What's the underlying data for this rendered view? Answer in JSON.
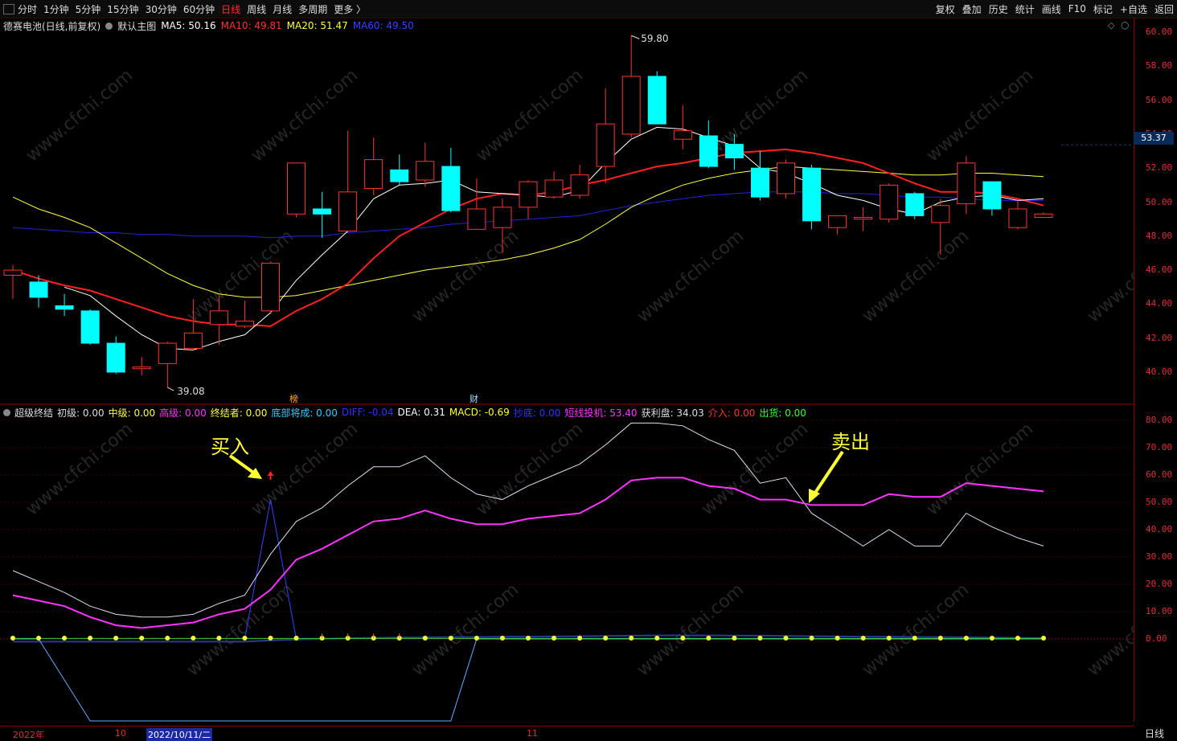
{
  "toolbar": {
    "periods": [
      "分时",
      "1分钟",
      "5分钟",
      "15分钟",
      "30分钟",
      "60分钟",
      "日线",
      "周线",
      "月线",
      "多周期",
      "更多 〉"
    ],
    "active_period": "日线",
    "right_buttons": [
      "复权",
      "叠加",
      "历史",
      "统计",
      "画线",
      "F10",
      "标记",
      "+自选",
      "返回"
    ]
  },
  "main_info": {
    "stock_name": "德赛电池(日线,前复权)",
    "template": "默认主图",
    "ma5": "MA5: 50.16",
    "ma10": "MA10: 49.81",
    "ma20": "MA20: 51.47",
    "ma60": "MA60: 49.50"
  },
  "indicator_info": {
    "name": "超级终结",
    "items": [
      {
        "text": "初级: 0.00",
        "color": "#dddddd"
      },
      {
        "text": "中级: 0.00",
        "color": "#ffff33"
      },
      {
        "text": "高级: 0.00",
        "color": "#ff33ff"
      },
      {
        "text": "终结者: 0.00",
        "color": "#ffff33"
      },
      {
        "text": "底部将成: 0.00",
        "color": "#33ccff"
      },
      {
        "text": "DIFF: -0.04",
        "color": "#3333ff"
      },
      {
        "text": "DEA: 0.31",
        "color": "#ffffff"
      },
      {
        "text": "MACD: -0.69",
        "color": "#ffff33"
      },
      {
        "text": "抄底: 0.00",
        "color": "#3333ff"
      },
      {
        "text": "短线投机: 53.40",
        "color": "#ff33ff"
      },
      {
        "text": "获利盘: 34.03",
        "color": "#dddddd"
      },
      {
        "text": "介入: 0.00",
        "color": "#ff3333"
      },
      {
        "text": "出货: 0.00",
        "color": "#33ff33"
      }
    ]
  },
  "price_axis": [
    "60.00",
    "58.00",
    "56.00",
    "54.00",
    "52.00",
    "50.00",
    "48.00",
    "46.00",
    "44.00",
    "42.00",
    "40.00"
  ],
  "indicator_axis": [
    "80.00",
    "70.00",
    "60.00",
    "50.00",
    "40.00",
    "30.00",
    "20.00",
    "10.00",
    "0.00"
  ],
  "current_price": "53.37",
  "high_label": "59.80",
  "low_label": "39.08",
  "markers": {
    "bang": "榜",
    "cai": "财"
  },
  "annotations": {
    "buy": "买入",
    "sell": "卖出"
  },
  "date_axis": {
    "year": "2022年",
    "m10": "10",
    "selected": "2022/10/11/二",
    "m11": "11"
  },
  "period_label": "日线",
  "colors": {
    "up": "#ff3333",
    "down": "#00ffff",
    "ma5": "#ffffff",
    "ma10": "#ff2020",
    "ma20": "#ffff44",
    "ma60": "#2222dd"
  },
  "chart_data": {
    "type": "candlestick",
    "candles": [
      {
        "o": 45.7,
        "c": 46.0,
        "h": 46.3,
        "l": 44.3
      },
      {
        "o": 45.3,
        "c": 44.4,
        "h": 45.7,
        "l": 43.8
      },
      {
        "o": 43.9,
        "c": 43.7,
        "h": 44.6,
        "l": 43.3
      },
      {
        "o": 43.6,
        "c": 41.7,
        "h": 43.7,
        "l": 41.6
      },
      {
        "o": 41.7,
        "c": 40.0,
        "h": 42.1,
        "l": 39.9
      },
      {
        "o": 40.2,
        "c": 40.3,
        "h": 40.9,
        "l": 39.8
      },
      {
        "o": 40.5,
        "c": 41.7,
        "h": 41.8,
        "l": 39.1
      },
      {
        "o": 41.4,
        "c": 42.3,
        "h": 44.3,
        "l": 41.3
      },
      {
        "o": 42.8,
        "c": 43.6,
        "h": 44.5,
        "l": 41.6
      },
      {
        "o": 42.7,
        "c": 43.0,
        "h": 44.2,
        "l": 42.6
      },
      {
        "o": 43.6,
        "c": 46.4,
        "h": 46.5,
        "l": 43.4
      },
      {
        "o": 49.3,
        "c": 52.3,
        "h": 52.3,
        "l": 49.1
      },
      {
        "o": 49.6,
        "c": 49.3,
        "h": 50.6,
        "l": 47.9
      },
      {
        "o": 48.3,
        "c": 50.6,
        "h": 54.2,
        "l": 48.2
      },
      {
        "o": 50.8,
        "c": 52.5,
        "h": 53.8,
        "l": 50.4
      },
      {
        "o": 51.9,
        "c": 51.2,
        "h": 52.8,
        "l": 51.0
      },
      {
        "o": 51.3,
        "c": 52.4,
        "h": 53.5,
        "l": 50.9
      },
      {
        "o": 52.1,
        "c": 49.5,
        "h": 53.2,
        "l": 49.4
      },
      {
        "o": 48.4,
        "c": 49.6,
        "h": 51.4,
        "l": 48.4
      },
      {
        "o": 48.5,
        "c": 49.7,
        "h": 50.2,
        "l": 47.0
      },
      {
        "o": 49.7,
        "c": 51.2,
        "h": 51.3,
        "l": 49.0
      },
      {
        "o": 50.3,
        "c": 51.3,
        "h": 51.8,
        "l": 50.2
      },
      {
        "o": 50.4,
        "c": 51.6,
        "h": 52.2,
        "l": 50.2
      },
      {
        "o": 52.1,
        "c": 54.6,
        "h": 56.7,
        "l": 51.1
      },
      {
        "o": 54.0,
        "c": 57.4,
        "h": 59.8,
        "l": 53.8
      },
      {
        "o": 57.4,
        "c": 54.6,
        "h": 57.7,
        "l": 54.6
      },
      {
        "o": 53.7,
        "c": 54.2,
        "h": 55.7,
        "l": 53.1
      },
      {
        "o": 53.9,
        "c": 52.1,
        "h": 54.8,
        "l": 52.0
      },
      {
        "o": 53.4,
        "c": 52.6,
        "h": 54.0,
        "l": 51.9
      },
      {
        "o": 52.0,
        "c": 50.3,
        "h": 53.0,
        "l": 50.1
      },
      {
        "o": 50.5,
        "c": 52.3,
        "h": 52.5,
        "l": 50.2
      },
      {
        "o": 52.0,
        "c": 48.9,
        "h": 52.2,
        "l": 48.4
      },
      {
        "o": 48.5,
        "c": 49.2,
        "h": 49.2,
        "l": 48.1
      },
      {
        "o": 49.0,
        "c": 49.1,
        "h": 49.7,
        "l": 48.3
      },
      {
        "o": 49.0,
        "c": 51.0,
        "h": 51.1,
        "l": 48.8
      },
      {
        "o": 50.5,
        "c": 49.2,
        "h": 50.6,
        "l": 49.0
      },
      {
        "o": 48.8,
        "c": 49.8,
        "h": 50.2,
        "l": 46.9
      },
      {
        "o": 49.9,
        "c": 52.3,
        "h": 52.7,
        "l": 49.3
      },
      {
        "o": 51.2,
        "c": 49.6,
        "h": 51.2,
        "l": 49.2
      },
      {
        "o": 48.5,
        "c": 49.6,
        "h": 50.2,
        "l": 48.4
      },
      {
        "o": 49.1,
        "c": 49.3,
        "h": 49.4,
        "l": 49.1
      }
    ],
    "ma5": [
      null,
      null,
      45.0,
      44.5,
      43.3,
      42.2,
      41.4,
      41.3,
      41.8,
      42.2,
      43.5,
      45.4,
      46.9,
      48.3,
      50.2,
      51.0,
      51.1,
      51.3,
      50.6,
      50.5,
      50.4,
      50.3,
      50.7,
      52.3,
      53.7,
      54.4,
      54.3,
      53.8,
      53.3,
      52.0,
      51.7,
      51.1,
      50.4,
      50.1,
      49.6,
      49.3,
      50.0,
      50.3,
      50.4,
      50.1,
      50.2
    ],
    "ma10": [
      46.0,
      45.5,
      45.1,
      44.8,
      44.3,
      43.8,
      43.3,
      43.0,
      42.8,
      42.8,
      42.7,
      43.6,
      44.3,
      45.2,
      46.7,
      48.0,
      48.8,
      49.6,
      50.2,
      50.5,
      50.4,
      50.6,
      51.0,
      51.3,
      51.7,
      52.1,
      52.3,
      52.6,
      52.9,
      53.0,
      53.1,
      52.9,
      52.6,
      52.3,
      51.7,
      51.1,
      50.6,
      50.6,
      50.5,
      50.2,
      49.8
    ],
    "ma20": [
      50.3,
      49.6,
      49.1,
      48.5,
      47.6,
      46.7,
      45.8,
      45.1,
      44.6,
      44.4,
      44.4,
      44.5,
      44.8,
      45.1,
      45.4,
      45.7,
      46.0,
      46.2,
      46.4,
      46.6,
      46.9,
      47.3,
      47.8,
      48.7,
      49.7,
      50.4,
      51.0,
      51.4,
      51.7,
      51.9,
      52.1,
      52.0,
      51.9,
      51.8,
      51.7,
      51.6,
      51.6,
      51.7,
      51.7,
      51.6,
      51.5
    ],
    "ma60": [
      48.5,
      48.4,
      48.3,
      48.2,
      48.2,
      48.1,
      48.1,
      48.0,
      48.0,
      48.0,
      47.9,
      48.0,
      48.0,
      48.2,
      48.3,
      48.4,
      48.5,
      48.7,
      48.8,
      48.9,
      49.0,
      49.1,
      49.2,
      49.5,
      49.8,
      50.0,
      50.2,
      50.4,
      50.5,
      50.6,
      50.6,
      50.6,
      50.5,
      50.5,
      50.4,
      50.3,
      50.3,
      50.2,
      50.1,
      50.1,
      50.1
    ],
    "indicator_white": [
      25,
      21,
      17,
      12,
      9,
      8,
      8,
      9,
      13,
      16,
      31,
      43,
      48,
      56,
      63,
      63,
      67,
      59,
      53,
      51,
      56,
      60,
      64,
      71,
      79,
      79,
      78,
      73,
      69,
      57,
      59,
      46,
      40,
      34,
      40,
      34,
      34,
      46,
      41,
      37,
      34
    ],
    "indicator_magenta": [
      16,
      14,
      12,
      8,
      5,
      4,
      5,
      6,
      9,
      11,
      18,
      29,
      33,
      38,
      43,
      44,
      47,
      44,
      42,
      42,
      44,
      45,
      46,
      51,
      58,
      59,
      59,
      56,
      55,
      51,
      51,
      49,
      49,
      49,
      53,
      52,
      52,
      57,
      56,
      55,
      54
    ],
    "indicator_blue": [
      {
        "i": 9,
        "v": 0
      },
      {
        "i": 10,
        "v": 51
      },
      {
        "i": 11,
        "v": 0
      }
    ],
    "indicator_cyan": [
      {
        "i": 0,
        "v": 0
      },
      {
        "i": 1,
        "v": 0
      },
      {
        "i": 3,
        "v": -30
      },
      {
        "i": 17,
        "v": -30
      },
      {
        "i": 18,
        "v": 0
      },
      {
        "i": 40,
        "v": 0
      }
    ],
    "indicator_darkline": [
      -1,
      -1,
      -1,
      -1,
      -1,
      -1,
      -1,
      -1,
      -1,
      -1,
      -0.5,
      -0.2,
      0,
      0.2,
      0.4,
      0.5,
      0.6,
      0.7,
      0.7,
      0.8,
      0.8,
      0.9,
      1.0,
      1.1,
      1.2,
      1.3,
      1.3,
      1.3,
      1.2,
      1.2,
      1.1,
      1.0,
      0.9,
      0.8,
      0.8,
      0.7,
      0.7,
      0.6,
      0.5,
      0.4,
      0.3
    ],
    "price_range": [
      38.5,
      61.0
    ],
    "indicator_range": [
      -33,
      86
    ]
  }
}
